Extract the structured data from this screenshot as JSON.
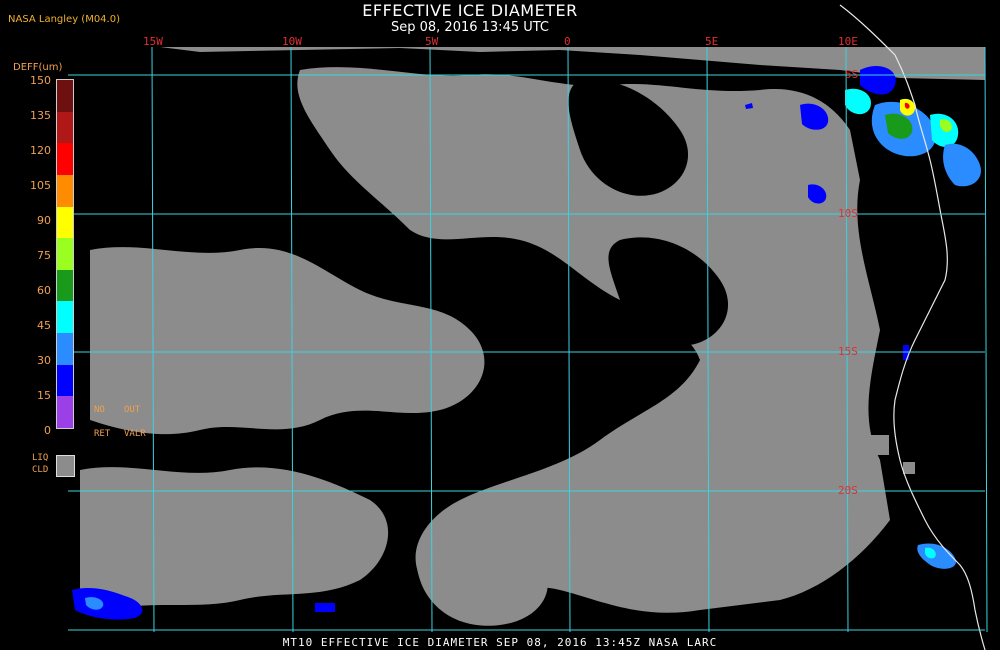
{
  "header": {
    "title": "EFFECTIVE ICE DIAMETER",
    "subtitle": "Sep 08, 2016 13:45 UTC",
    "producer": "NASA Langley (M04.0)"
  },
  "longitude_labels": [
    "15W",
    "10W",
    "5W",
    "0",
    "5E",
    "10E"
  ],
  "latitude_labels": [
    "5S",
    "10S",
    "15S",
    "20S"
  ],
  "legend": {
    "title": "DEFF(um)",
    "ticks": [
      "150",
      "135",
      "120",
      "105",
      "90",
      "75",
      "60",
      "45",
      "30",
      "15",
      "0"
    ],
    "colors": [
      "#6e0f10",
      "#b01818",
      "#ff0000",
      "#ff8c00",
      "#ffff00",
      "#9aff20",
      "#1a9a1a",
      "#00ffff",
      "#2a8cff",
      "#0000ff",
      "#9a40e6"
    ],
    "no_ret_label": [
      "NO",
      "RET"
    ],
    "out_val_label": [
      "OUT",
      "VALR"
    ],
    "liq_cld_label": [
      "LIQ",
      "CLD"
    ],
    "liq_cld_color": "#8c8c8c"
  },
  "colors": {
    "grid": "#3ad3e0",
    "cloud_gray": "#8c8c8c",
    "coast": "#e8e8e8",
    "label_red": "#e03030",
    "legend_orange": "#f0a050"
  },
  "footer": "MT10  EFFECTIVE ICE DIAMETER   SEP 08, 2016 13:45Z   NASA LARC"
}
